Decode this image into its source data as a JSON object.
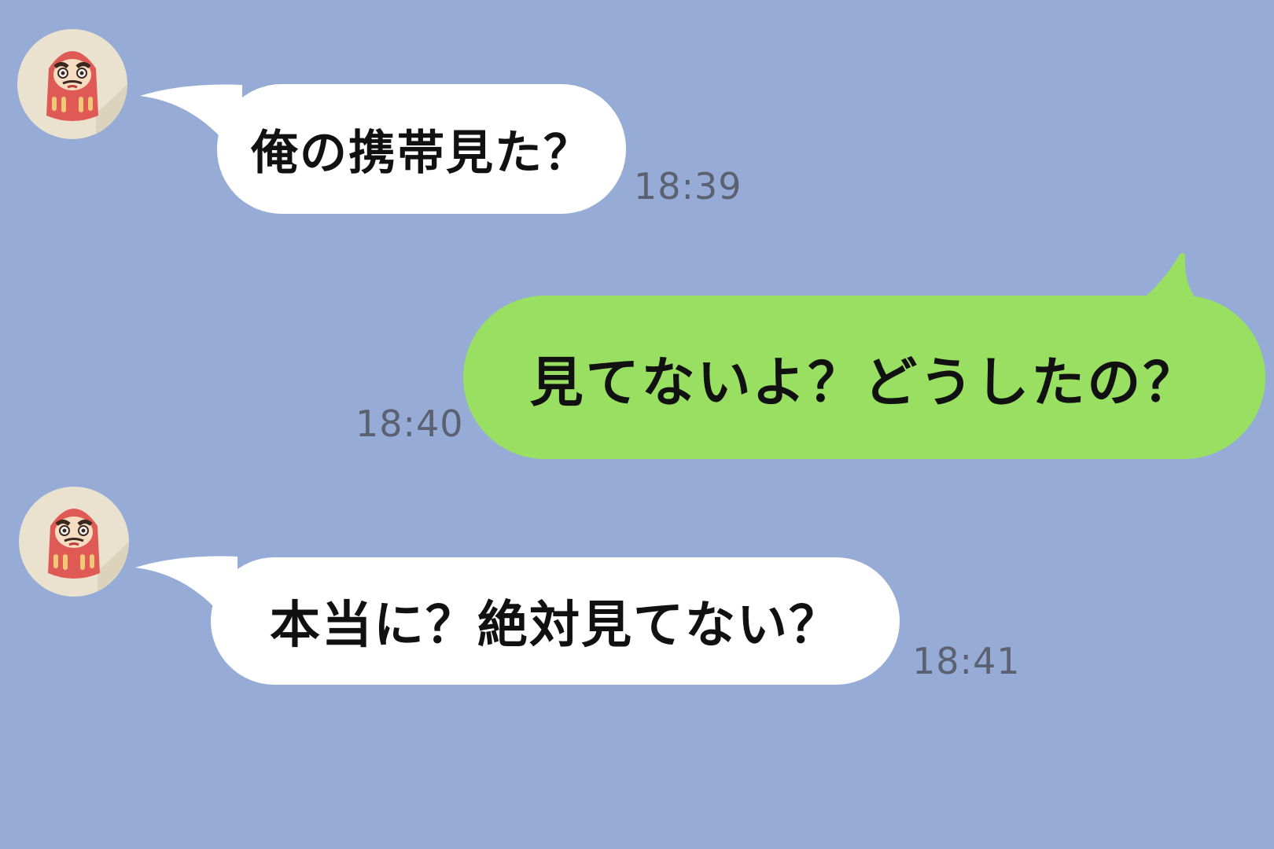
{
  "colors": {
    "background": "#96acd6",
    "incoming_bubble": "#ffffff",
    "outgoing_bubble": "#99e062",
    "timestamp_text": "#5b6170"
  },
  "contact": {
    "avatar_icon": "daruma-icon"
  },
  "messages": [
    {
      "direction": "incoming",
      "text": "俺の携帯見た？",
      "time": "18:39"
    },
    {
      "direction": "outgoing",
      "text": "見てないよ？どうしたの？",
      "time": "18:40"
    },
    {
      "direction": "incoming",
      "text": "本当に？絶対見てない？",
      "time": "18:41"
    }
  ]
}
